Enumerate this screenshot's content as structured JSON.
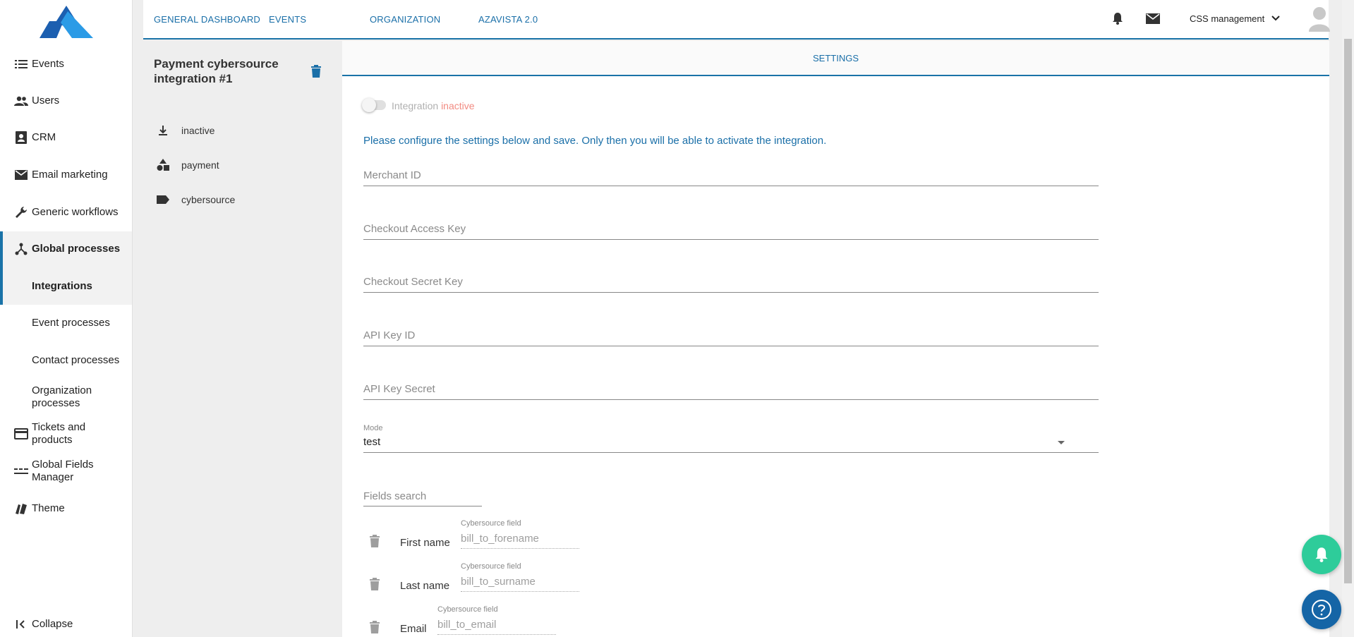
{
  "sidebar": {
    "logo_icon": "azavista-logo",
    "items": [
      {
        "label": "Events",
        "icon": "list-icon"
      },
      {
        "label": "Users",
        "icon": "users-icon"
      },
      {
        "label": "CRM",
        "icon": "contacts-icon"
      },
      {
        "label": "Email marketing",
        "icon": "mail-icon"
      },
      {
        "label": "Generic workflows",
        "icon": "wrench-icon"
      },
      {
        "label": "Global processes",
        "icon": "fork-icon"
      },
      {
        "label": "Integrations"
      },
      {
        "label": "Event processes"
      },
      {
        "label": "Contact processes"
      },
      {
        "label": "Organization processes"
      },
      {
        "label": "Tickets and products",
        "icon": "card-icon"
      },
      {
        "label": "Global Fields Manager",
        "icon": "fields-icon"
      },
      {
        "label": "Theme",
        "icon": "theme-icon"
      }
    ],
    "collapse_label": "Collapse"
  },
  "topnav": {
    "links": [
      "GENERAL DASHBOARD",
      "EVENTS",
      "ORGANIZATION",
      "AZAVISTA 2.0"
    ],
    "account_label": "CSS management"
  },
  "integration": {
    "title": "Payment cybersource integration #1",
    "meta": [
      {
        "label": "inactive",
        "icon": "download-icon"
      },
      {
        "label": "payment",
        "icon": "shapes-icon"
      },
      {
        "label": "cybersource",
        "icon": "tag-icon"
      }
    ]
  },
  "settings": {
    "tab_label": "SETTINGS",
    "toggle_label": "Integration",
    "toggle_state": "inactive",
    "notice": "Please configure the settings below and save. Only then you will be able to activate the integration.",
    "fields": {
      "merchant_id": "Merchant ID",
      "checkout_access_key": "Checkout Access Key",
      "checkout_secret_key": "Checkout Secret Key",
      "api_key_id": "API Key ID",
      "api_key_secret": "API Key Secret"
    },
    "mode": {
      "label": "Mode",
      "value": "test"
    },
    "fields_search_placeholder": "Fields search",
    "mappings": [
      {
        "name": "First name",
        "caption": "Cybersource field",
        "placeholder": "bill_to_forename"
      },
      {
        "name": "Last name",
        "caption": "Cybersource field",
        "placeholder": "bill_to_surname"
      },
      {
        "name": "Email",
        "caption": "Cybersource field",
        "placeholder": "bill_to_email"
      }
    ]
  },
  "colors": {
    "accent": "#1a73a8",
    "inactive": "#f28b82",
    "fab_green": "#2ecc9a",
    "fab_blue": "#1565a6"
  }
}
